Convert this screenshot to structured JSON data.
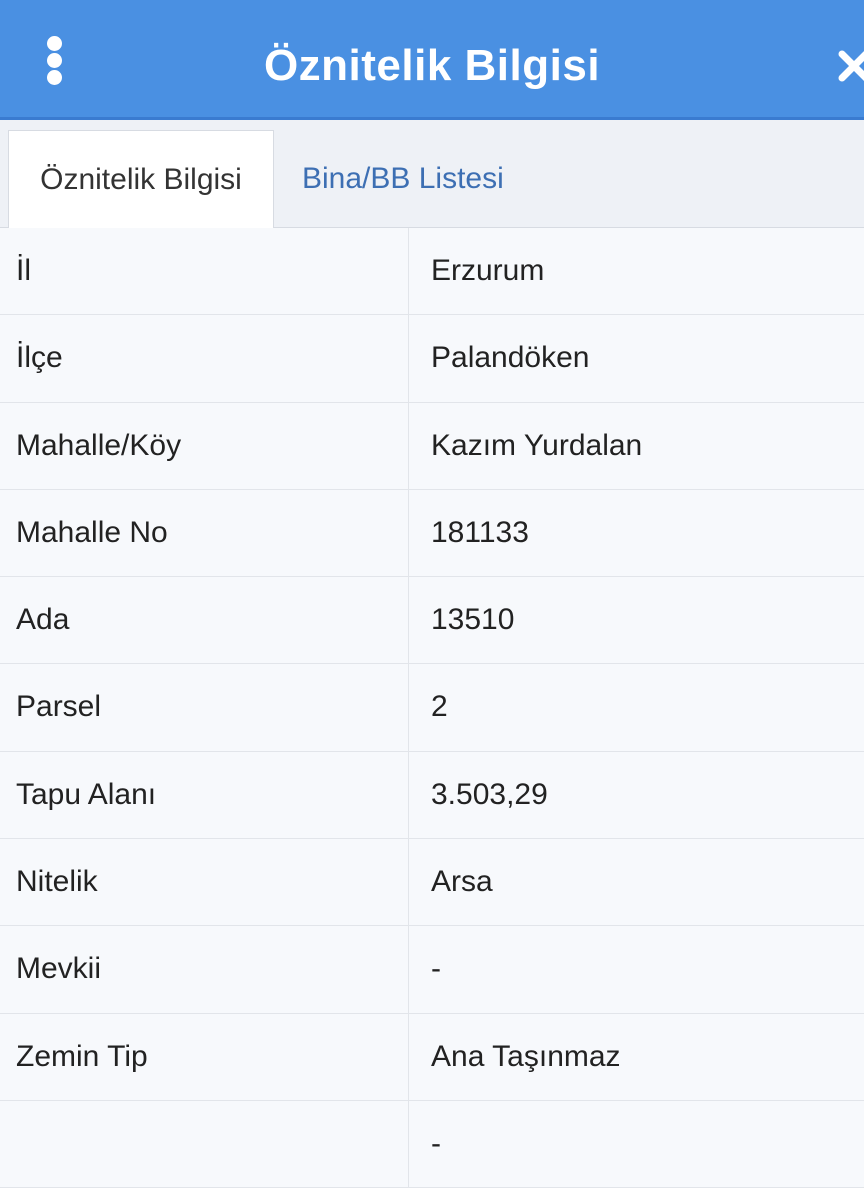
{
  "header": {
    "title": "Öznitelik Bilgisi"
  },
  "tabs": [
    {
      "label": "Öznitelik Bilgisi",
      "active": true
    },
    {
      "label": "Bina/BB Listesi",
      "active": false
    }
  ],
  "rows": [
    {
      "label": "İl",
      "value": "Erzurum"
    },
    {
      "label": "İlçe",
      "value": "Palandöken"
    },
    {
      "label": "Mahalle/Köy",
      "value": "Kazım Yurdalan"
    },
    {
      "label": "Mahalle No",
      "value": "181133"
    },
    {
      "label": "Ada",
      "value": "13510"
    },
    {
      "label": "Parsel",
      "value": "2"
    },
    {
      "label": "Tapu Alanı",
      "value": "3.503,29"
    },
    {
      "label": "Nitelik",
      "value": "Arsa"
    },
    {
      "label": "Mevkii",
      "value": "-"
    },
    {
      "label": "Zemin Tip",
      "value": "Ana Taşınmaz"
    },
    {
      "label": "",
      "value": "-"
    }
  ],
  "colors": {
    "header_bg": "#4a90e2",
    "tab_link": "#3d6fb3",
    "row_bg": "#f7f9fc"
  },
  "icons": {
    "menu": "more-vertical-icon",
    "close": "close-icon"
  }
}
